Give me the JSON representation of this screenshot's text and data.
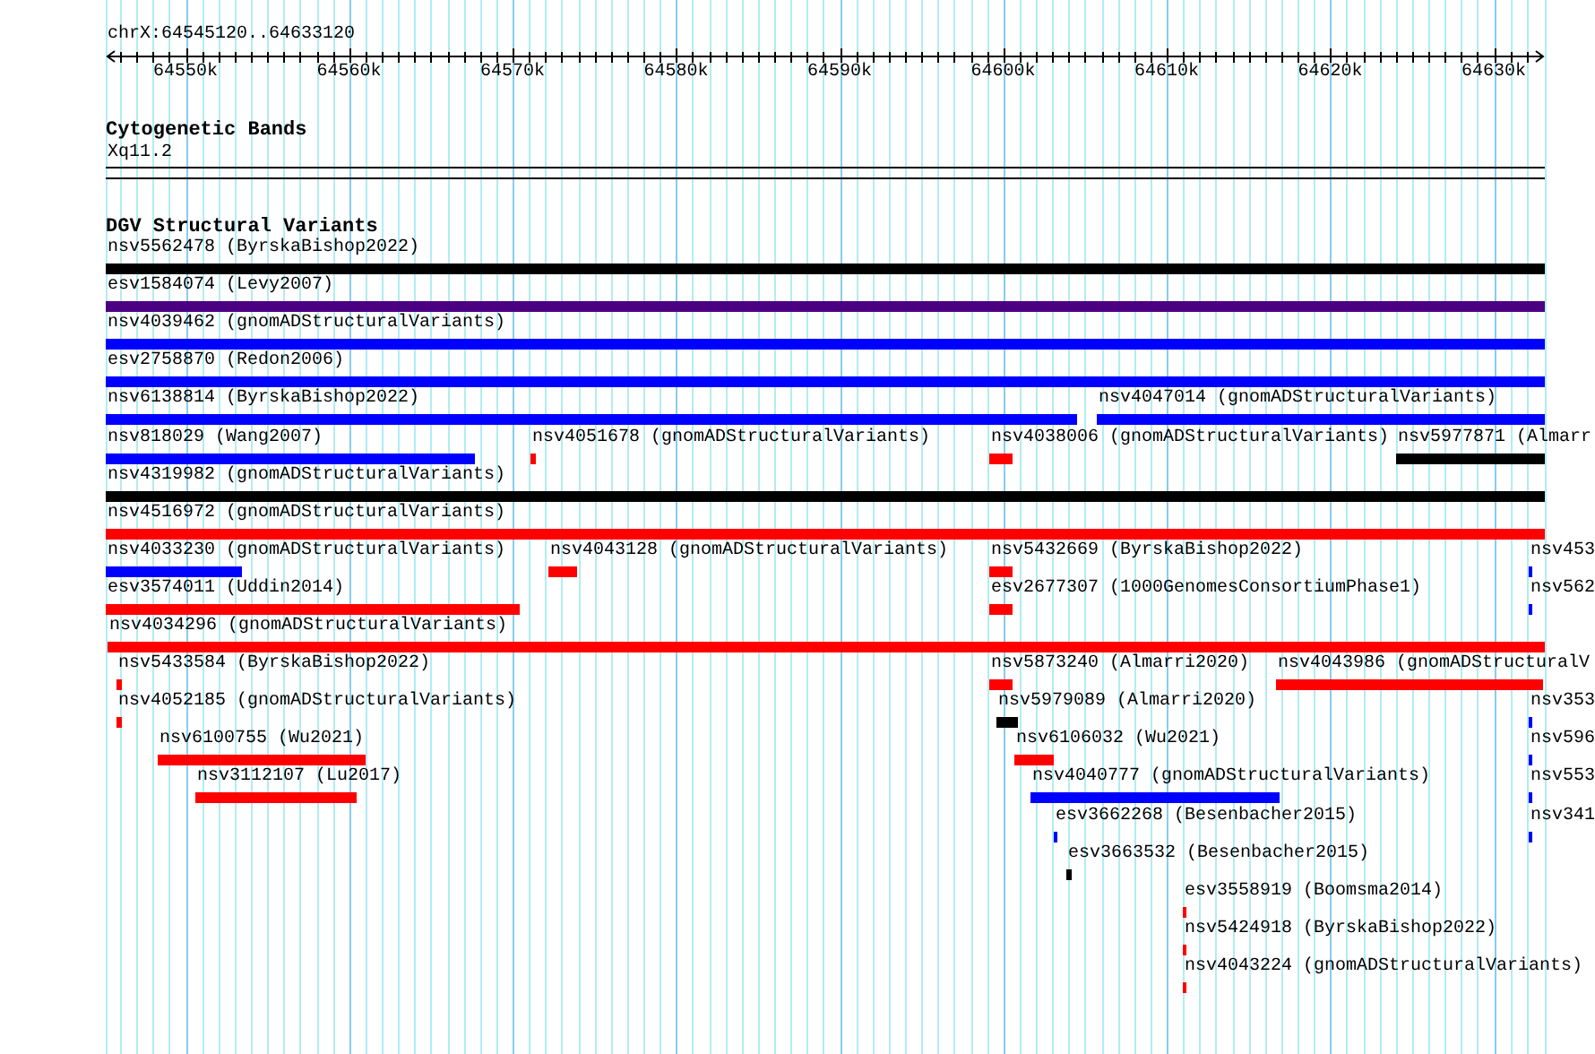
{
  "location": "chrX:64545120..64633120",
  "ruler": {
    "tick_labels": [
      "64550k",
      "64560k",
      "64570k",
      "64580k",
      "64590k",
      "64600k",
      "64610k",
      "64620k",
      "64630k"
    ]
  },
  "tracks": [
    {
      "kind": "cytoband",
      "title": "Cytogenetic Bands",
      "band": "Xq11.2"
    },
    {
      "kind": "variants",
      "title": "DGV Structural Variants",
      "rows": [
        {
          "features": [
            {
              "label": "nsv5562478 (ByrskaBishop2022)",
              "color": "#000000"
            }
          ]
        },
        {
          "features": [
            {
              "label": "esv1584074 (Levy2007)",
              "color": "#4b0082"
            }
          ]
        },
        {
          "features": [
            {
              "label": "nsv4039462 (gnomADStructuralVariants)",
              "color": "#0000ff"
            }
          ]
        },
        {
          "features": [
            {
              "label": "esv2758870 (Redon2006)",
              "color": "#0000ff"
            }
          ]
        },
        {
          "features": [
            {
              "label": "nsv6138814 (ByrskaBishop2022)",
              "color": "#0000ff"
            },
            {
              "label": "nsv4047014 (gnomADStructuralVariants)",
              "color": "#0000ff"
            }
          ]
        },
        {
          "features": [
            {
              "label": "nsv818029 (Wang2007)",
              "color": "#0000ff"
            },
            {
              "label": "nsv4051678 (gnomADStructuralVariants)",
              "color": "#ff0000"
            },
            {
              "label": "nsv4038006 (gnomADStructuralVariants)",
              "color": "#ff0000"
            },
            {
              "label": "nsv5977871 (Almarr",
              "color": "#000000"
            }
          ]
        },
        {
          "features": [
            {
              "label": "nsv4319982 (gnomADStructuralVariants)",
              "color": "#000000"
            }
          ]
        },
        {
          "features": [
            {
              "label": "nsv4516972 (gnomADStructuralVariants)",
              "color": "#ff0000"
            }
          ]
        },
        {
          "features": [
            {
              "label": "nsv4033230 (gnomADStructuralVariants)",
              "color": "#0000ff"
            },
            {
              "label": "nsv4043128 (gnomADStructuralVariants)",
              "color": "#ff0000"
            },
            {
              "label": "nsv5432669 (ByrskaBishop2022)",
              "color": "#ff0000"
            },
            {
              "label": "nsv453",
              "color": "#0000ff"
            }
          ]
        },
        {
          "features": [
            {
              "label": "esv3574011 (Uddin2014)",
              "color": "#ff0000"
            },
            {
              "label": "esv2677307 (1000GenomesConsortiumPhase1)",
              "color": "#ff0000"
            },
            {
              "label": "nsv562",
              "color": "#0000ff"
            }
          ]
        },
        {
          "features": [
            {
              "label": "nsv4034296 (gnomADStructuralVariants)",
              "color": "#ff0000"
            }
          ]
        },
        {
          "features": [
            {
              "label": "nsv5433584 (ByrskaBishop2022)",
              "color": "#ff0000"
            },
            {
              "label": "nsv5873240 (Almarri2020)",
              "color": "#ff0000"
            },
            {
              "label": "nsv4043986 (gnomADStructuralV",
              "color": "#ff0000"
            }
          ]
        },
        {
          "features": [
            {
              "label": "nsv4052185 (gnomADStructuralVariants)",
              "color": "#ff0000"
            },
            {
              "label": "nsv5979089 (Almarri2020)",
              "color": "#000000"
            },
            {
              "label": "nsv353",
              "color": "#0000ff"
            }
          ]
        },
        {
          "features": [
            {
              "label": "nsv6100755 (Wu2021)",
              "color": "#ff0000"
            },
            {
              "label": "nsv6106032 (Wu2021)",
              "color": "#ff0000"
            },
            {
              "label": "nsv596",
              "color": "#0000ff"
            }
          ]
        },
        {
          "features": [
            {
              "label": "nsv3112107 (Lu2017)",
              "color": "#ff0000"
            },
            {
              "label": "nsv4040777 (gnomADStructuralVariants)",
              "color": "#0000ff"
            },
            {
              "label": "nsv553",
              "color": "#0000ff"
            }
          ]
        },
        {
          "features": [
            {
              "label": "esv3662268 (Besenbacher2015)",
              "color": "#0000ff"
            },
            {
              "label": "nsv341",
              "color": "#0000ff"
            }
          ]
        },
        {
          "features": [
            {
              "label": "esv3663532 (Besenbacher2015)",
              "color": "#000000"
            }
          ]
        },
        {
          "features": [
            {
              "label": "esv3558919 (Boomsma2014)",
              "color": "#ff0000"
            }
          ]
        },
        {
          "features": [
            {
              "label": "nsv5424918 (ByrskaBishop2022)",
              "color": "#ff0000"
            }
          ]
        },
        {
          "features": [
            {
              "label": "nsv4043224 (gnomADStructuralVariants)",
              "color": "#ff0000"
            }
          ]
        }
      ]
    }
  ]
}
